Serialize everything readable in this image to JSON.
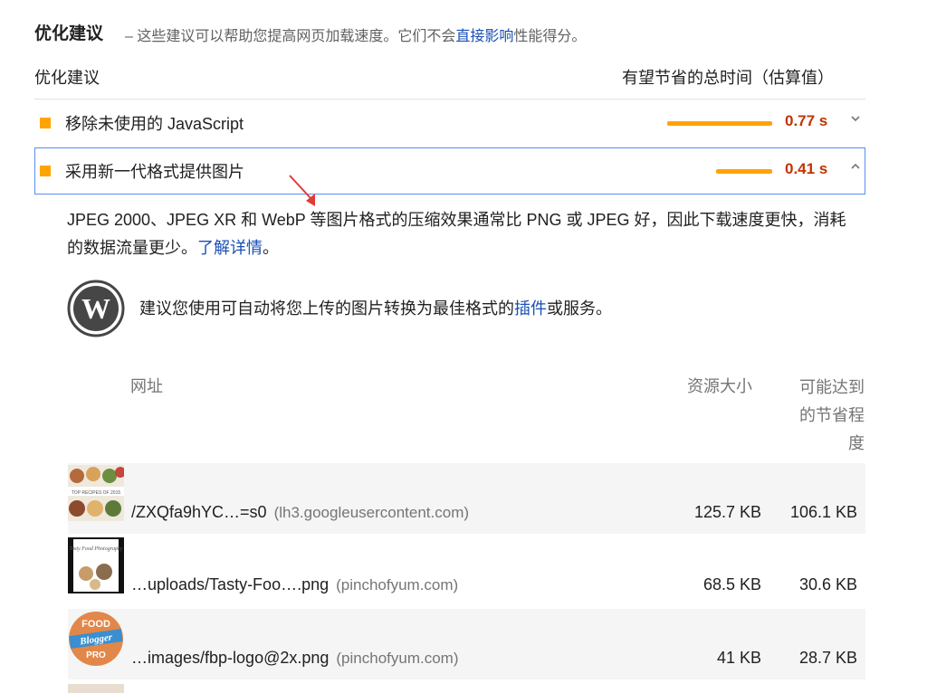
{
  "section": {
    "title": "优化建议",
    "desc_before": "– 这些建议可以帮助您提高网页加载速度。它们不会",
    "desc_link": "直接影响",
    "desc_after": "性能得分。"
  },
  "table_header": {
    "left": "优化建议",
    "right": "有望节省的总时间（估算值）"
  },
  "audits": [
    {
      "title": "移除未使用的 JavaScript",
      "savings": "0.77 s",
      "bar_fraction": 0.77,
      "expanded": false
    },
    {
      "title": "采用新一代格式提供图片",
      "savings": "0.41 s",
      "bar_fraction": 0.41,
      "expanded": true
    }
  ],
  "details": {
    "description": "JPEG 2000、JPEG XR 和 WebP 等图片格式的压缩效果通常比 PNG 或 JPEG 好，因此下载速度更快，消耗的数据流量更少。",
    "learn_more": "了解详情",
    "learn_more_end": "。",
    "wp_before": "建议您使用可自动将您上传的图片转换为最佳格式的",
    "wp_link": "插件",
    "wp_after": "或服务。",
    "columns": {
      "url": "网址",
      "size": "资源大小",
      "savings_line1": "可能达到",
      "savings_line2": "的节省程",
      "savings_line3": "度"
    },
    "rows": [
      {
        "url": "/ZXQfa9hYC…=s0",
        "host": "(lh3.googleusercontent.com)",
        "size": "125.7 KB",
        "savings": "106.1 KB",
        "thumb_text": "TOP RECIPES OF 2015"
      },
      {
        "url": "…uploads/Tasty-Foo….png",
        "host": "(pinchofyum.com)",
        "size": "68.5 KB",
        "savings": "30.6 KB",
        "thumb_text": "Tasty Food Photography"
      },
      {
        "url": "…images/fbp-logo@2x.png",
        "host": "(pinchofyum.com)",
        "size": "41 KB",
        "savings": "28.7 KB",
        "thumb_text_1": "FOOD",
        "thumb_text_2": "Blogger",
        "thumb_text_3": "PRO"
      }
    ]
  },
  "colors": {
    "accent_orange": "#ffa400",
    "savings_red": "#c33300",
    "link_blue": "#1a4fb4",
    "focus_border": "#5b8ff0"
  }
}
